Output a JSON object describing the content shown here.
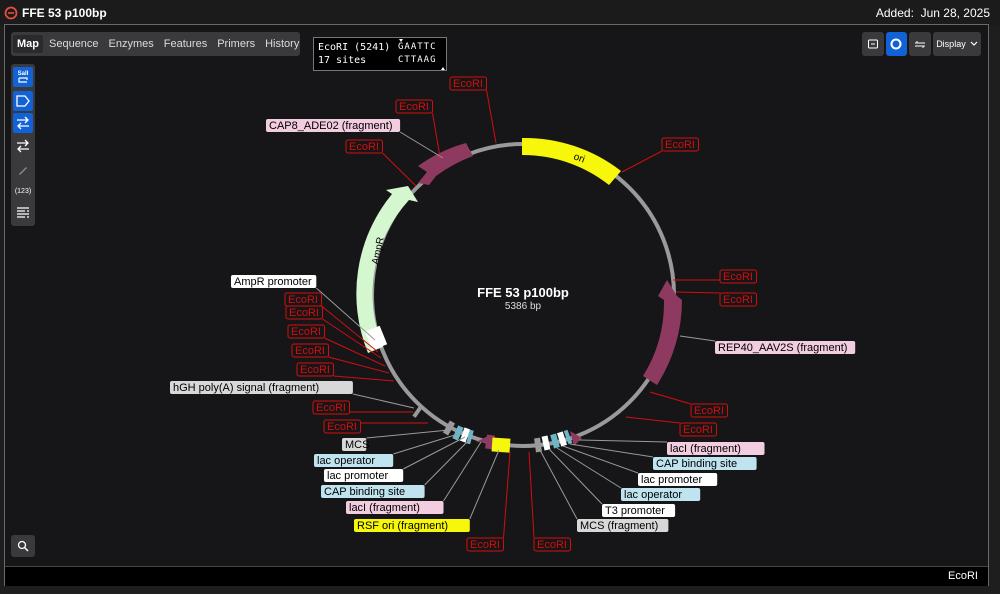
{
  "app": {
    "title": "FFE 53 p100bp",
    "added_label": "Added:",
    "added_date": "Jun 28, 2025"
  },
  "tabs": [
    {
      "label": "Map",
      "active": true
    },
    {
      "label": "Sequence"
    },
    {
      "label": "Enzymes"
    },
    {
      "label": "Features"
    },
    {
      "label": "Primers"
    },
    {
      "label": "History"
    }
  ],
  "toolbar": {
    "sall_label": "SalI",
    "number_label": "(123)",
    "icons": [
      "restriction-site-icon",
      "feature-label-icon",
      "strand-swap-icon",
      "arrows-swap-icon",
      "pencil-icon",
      "numbering-icon",
      "text-layout-icon"
    ]
  },
  "display_button": {
    "label": "Display"
  },
  "enzyme_box": {
    "name_line": "EcoRI (5241)",
    "sites_line": "17 sites",
    "seq_top": "GAATTC",
    "seq_bottom": "CTTAAG"
  },
  "plasmid": {
    "name": "FFE 53 p100bp",
    "length": "5386 bp",
    "colors": {
      "ori": "#f7f70b",
      "ampr": "#d4f7d0",
      "fragment": "#8e3960",
      "backbone": "#9a9a9a",
      "enzyme": "#d40d0d"
    }
  },
  "labels": {
    "ecori": "EcoRI",
    "cap8": "CAP8_ADE02 (fragment)",
    "ori": "ori",
    "ampr": "AmpR",
    "ampr_promoter": "AmpR promoter",
    "hgh": "hGH poly(A) signal (fragment)",
    "rep40": "REP40_AAV2S (fragment)",
    "mcs": "MCS",
    "lac_operator": "lac operator",
    "lac_promoter": "lac promoter",
    "cap_binding": "CAP binding site",
    "laci_fragment": "lacI (fragment)",
    "rsf_ori": "RSF ori (fragment)",
    "t3_promoter": "T3 promoter",
    "mcs_fragment": "MCS (fragment)"
  },
  "status": {
    "selected_enzyme": "EcoRI"
  }
}
